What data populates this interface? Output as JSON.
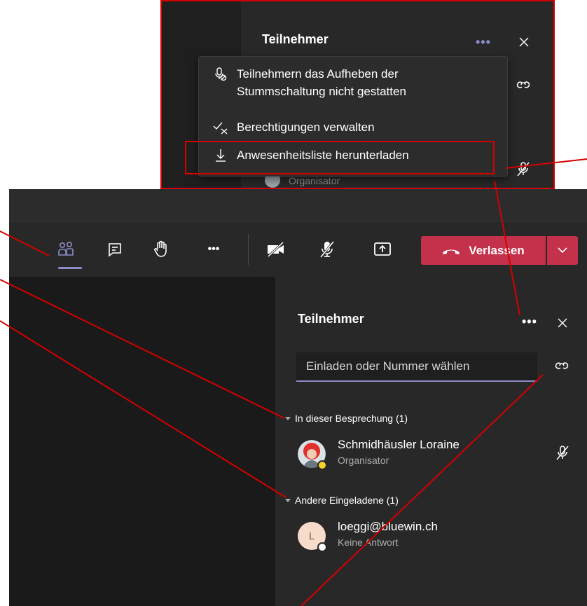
{
  "callout": {
    "panel_title": "Teilnehmer",
    "more_label": "•••",
    "menu": [
      {
        "icon": "mic-off-icon",
        "label_line1": "Teilnehmern das Aufheben der",
        "label_line2": "Stummschaltung nicht gestatten"
      },
      {
        "icon": "permissions-icon",
        "label": "Berechtigungen verwalten"
      },
      {
        "icon": "download-icon",
        "label": "Anwesenheitsliste herunterladen"
      }
    ],
    "behind_label": "Organisator"
  },
  "toolbar": {
    "more_label": "•••",
    "leave_label": "Verlassen",
    "buttons": [
      "people-icon",
      "chat-icon",
      "raise-hand-icon",
      "more-icon",
      "camera-off-icon",
      "mic-off-icon",
      "share-screen-icon"
    ]
  },
  "panel": {
    "title": "Teilnehmer",
    "more_label": "•••",
    "invite_placeholder": "Einladen oder Nummer wählen",
    "section_meeting": "In dieser Besprechung (1)",
    "section_invited": "Andere Eingeladene (1)",
    "participants": [
      {
        "name": "Schmidhäusler Loraine",
        "role": "Organisator"
      }
    ],
    "invited": [
      {
        "initial": "L",
        "name": "loeggi@bluewin.ch",
        "status": "Keine Antwort"
      }
    ]
  },
  "colors": {
    "accent": "#8b8cc7",
    "leave": "#c4314b",
    "annotation": "#d40000",
    "panel_bg": "#292828"
  }
}
